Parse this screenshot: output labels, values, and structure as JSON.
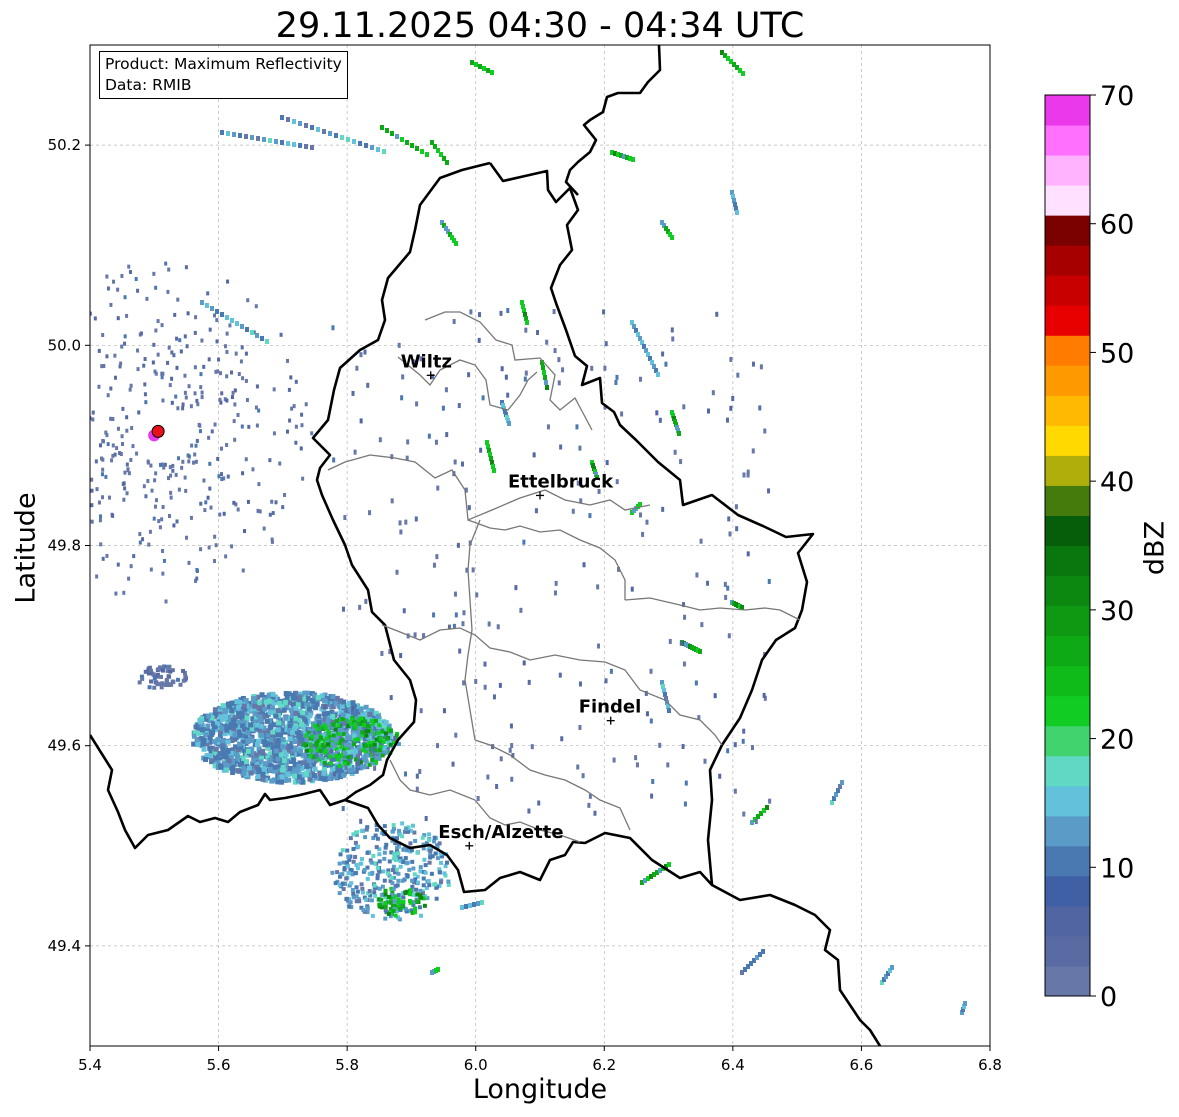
{
  "title": "29.11.2025 04:30 - 04:34 UTC",
  "info": {
    "product": "Product: Maximum Reflectivity",
    "source": "Data: RMIB"
  },
  "axes": {
    "xlabel": "Longitude",
    "ylabel": "Latitude",
    "xlim": [
      5.4,
      6.8
    ],
    "ylim": [
      49.3,
      50.3
    ],
    "x_ticks": [
      "5.4",
      "5.6",
      "5.8",
      "6.0",
      "6.2",
      "6.4",
      "6.6",
      "6.8"
    ],
    "y_ticks": [
      "49.4",
      "49.6",
      "49.8",
      "50.0",
      "50.2"
    ],
    "grid": true
  },
  "colorbar": {
    "label": "dBZ",
    "min": 0,
    "max": 70,
    "ticks": [
      "0",
      "10",
      "20",
      "30",
      "40",
      "50",
      "60",
      "70"
    ],
    "colors": [
      "#6677a8",
      "#586ba3",
      "#5065a2",
      "#4060a5",
      "#4a78b0",
      "#5a9cc7",
      "#62c2dc",
      "#5fd9c4",
      "#40d36e",
      "#11cc22",
      "#0fbb18",
      "#0eaa15",
      "#0d9912",
      "#0c8810",
      "#0a770e",
      "#065d0a",
      "#457a0d",
      "#aeaf0b",
      "#ffd900",
      "#ffba00",
      "#ff9900",
      "#ff7c00",
      "#e80000",
      "#c90000",
      "#a60000",
      "#7b0000",
      "#ffe0ff",
      "#ffb3ff",
      "#ff70ff",
      "#ea38ea"
    ]
  },
  "cities": [
    {
      "name": "Wiltz",
      "lon": 5.93,
      "lat": 49.97
    },
    {
      "name": "Ettelbruck",
      "lon": 6.1,
      "lat": 49.85
    },
    {
      "name": "Findel",
      "lon": 6.21,
      "lat": 49.625
    },
    {
      "name": "Esch/Alzette",
      "lon": 5.99,
      "lat": 49.5
    }
  ],
  "radar_site": {
    "lon": 5.506,
    "lat": 49.914,
    "color": "#e8101a"
  }
}
